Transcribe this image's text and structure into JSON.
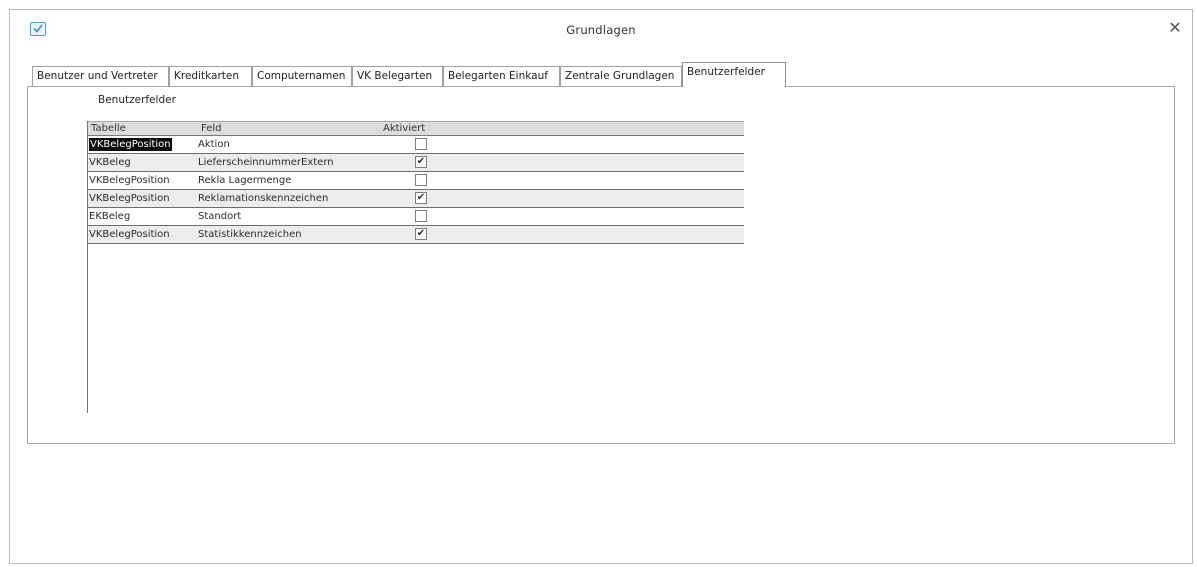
{
  "window": {
    "title": "Grundlagen",
    "close_symbol": "✕"
  },
  "tabs": [
    {
      "label": "Benutzer und Vertreter"
    },
    {
      "label": "Kreditkarten"
    },
    {
      "label": "Computernamen"
    },
    {
      "label": "VK Belegarten"
    },
    {
      "label": "Belegarten Einkauf"
    },
    {
      "label": "Zentrale Grundlagen"
    },
    {
      "label": "Benutzerfelder"
    }
  ],
  "active_tab": "Benutzerfelder",
  "panel": {
    "group_label": "Benutzerfelder"
  },
  "grid": {
    "columns": [
      "Tabelle",
      "Feld",
      "Aktiviert"
    ],
    "rows": [
      {
        "tabelle": "VKBelegPosition",
        "feld": "Aktion",
        "aktiviert": false
      },
      {
        "tabelle": "VKBeleg",
        "feld": "LieferscheinnummerExtern",
        "aktiviert": true
      },
      {
        "tabelle": "VKBelegPosition",
        "feld": "Rekla Lagermenge",
        "aktiviert": false
      },
      {
        "tabelle": "VKBelegPosition",
        "feld": "Reklamationskennzeichen",
        "aktiviert": true
      },
      {
        "tabelle": "EKBeleg",
        "feld": "Standort",
        "aktiviert": false
      },
      {
        "tabelle": "VKBelegPosition",
        "feld": "Statistikkennzeichen",
        "aktiviert": true
      }
    ],
    "check_symbol": "✔"
  }
}
